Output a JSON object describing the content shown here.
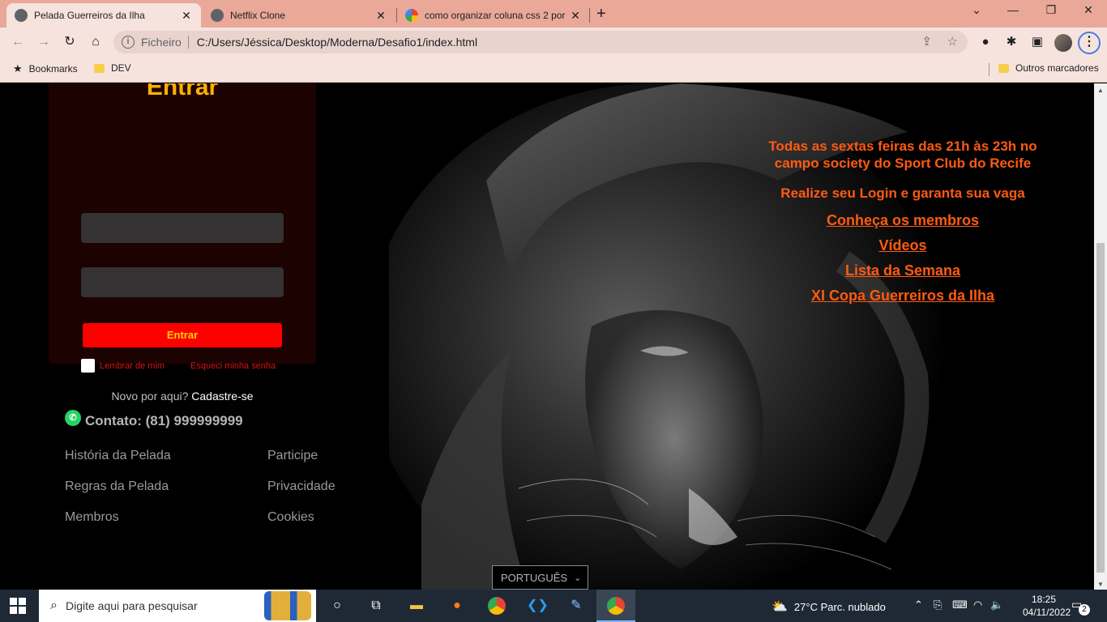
{
  "browser": {
    "tabs": [
      {
        "title": "Pelada Guerreiros da Ilha",
        "active": true
      },
      {
        "title": "Netflix Clone",
        "active": false
      },
      {
        "title": "como organizar coluna css 2 por",
        "active": false
      }
    ],
    "close_glyph": "✕",
    "new_tab_glyph": "+",
    "address": {
      "protocol_label": "Ficheiro",
      "url": "C:/Users/Jéssica/Desktop/Moderna/Desafio1/index.html"
    },
    "bookmarks": [
      {
        "label": "Bookmarks",
        "icon": "star-icon"
      },
      {
        "label": "DEV",
        "icon": "folder-icon"
      }
    ],
    "other_bookmarks": "Outros marcadores",
    "colors": {
      "tabbar": "#e9a898",
      "toolbar": "#f7e3de"
    }
  },
  "login": {
    "title": "Entrar",
    "username_value": "",
    "password_value": "",
    "submit_label": "Entrar",
    "remember_label": "Lembrar de mim",
    "forgot_label": "Esqueci minha senha",
    "signup_prefix": "Novo por aqui?",
    "signup_link": "Cadastre-se"
  },
  "info": {
    "schedule": "Todas as sextas feiras das 21h às 23h no campo society do Sport Club do Recife",
    "cta": "Realize seu Login e garanta sua vaga",
    "links": [
      "Conheça os membros",
      "Vídeos",
      "Lista da Semana",
      "XI Copa Guerreiros da Ilha"
    ]
  },
  "footer": {
    "contact": "Contato: (81) 999999999",
    "links_col1": [
      "História da Pelada",
      "Regras da Pelada",
      "Membros"
    ],
    "links_col2": [
      "Participe",
      "Privacidade",
      "Cookies"
    ],
    "language": "PORTUGUÊS"
  },
  "accent_colors": {
    "title": "#ffb000",
    "button": "#ff0000",
    "links": "#ff5a12"
  },
  "taskbar": {
    "search_placeholder": "Digite aqui para pesquisar",
    "weather": "27°C  Parc. nublado",
    "time": "18:25",
    "date": "04/11/2022",
    "notifications": "2"
  }
}
